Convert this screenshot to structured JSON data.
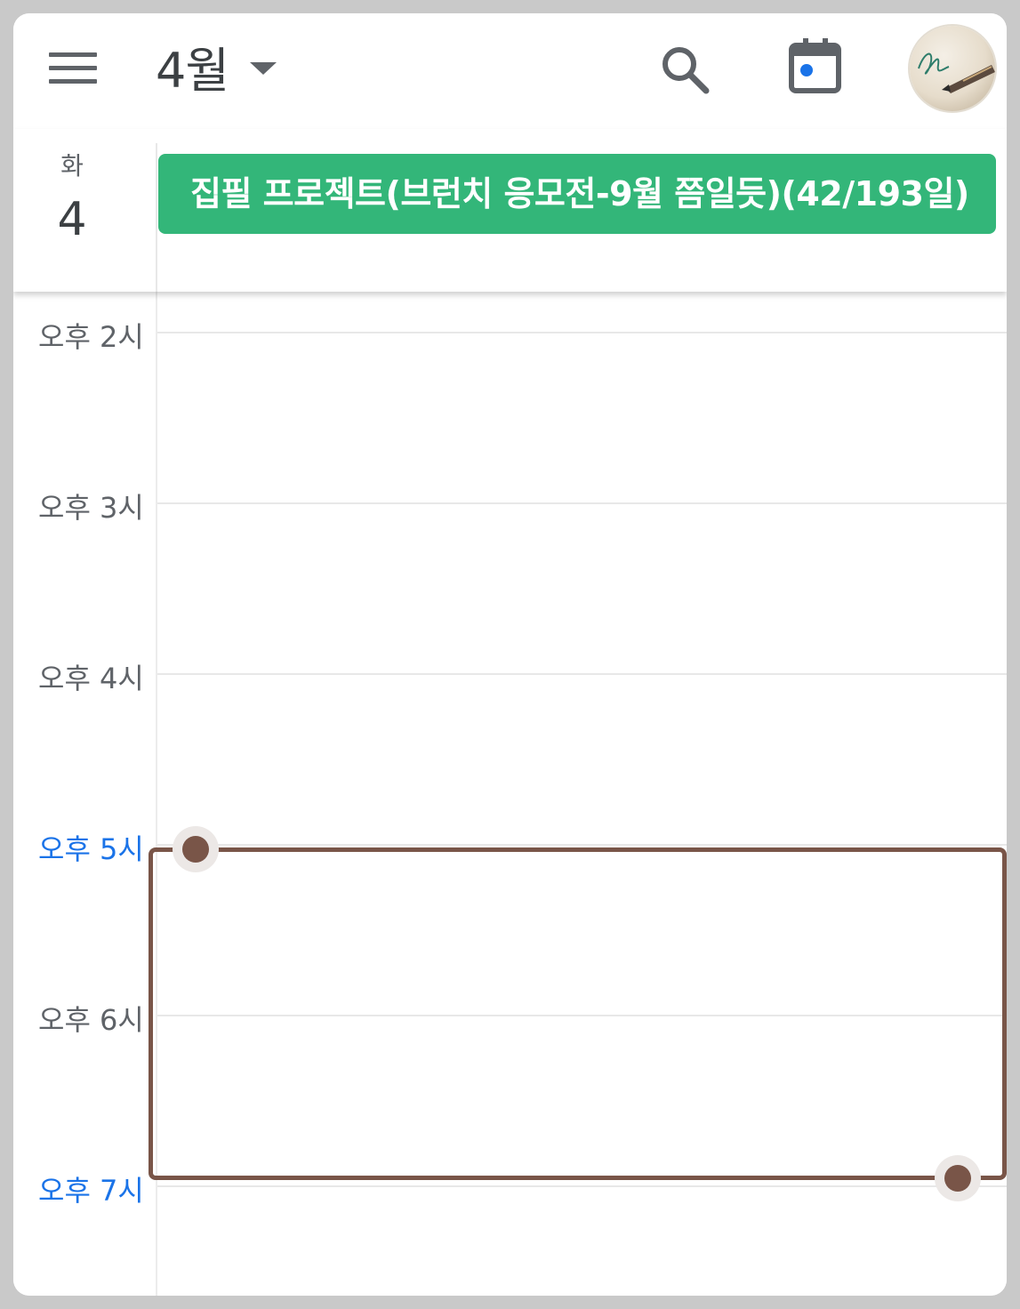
{
  "appbar": {
    "menu_icon": "menu-icon",
    "month_label": "4월",
    "month_caret_icon": "arrow-drop-down-icon",
    "search_icon": "search-icon",
    "today_icon": "calendar-today-icon",
    "avatar_icon": "profile-avatar"
  },
  "day": {
    "weekday": "화",
    "date": "4"
  },
  "all_day_events": [
    {
      "title": "집필 프로젝트(브런치 응모전-9월 쯤일듯)(42/193일)",
      "color": "#33b679"
    }
  ],
  "hours": [
    {
      "label": "오후 2시",
      "accent": false
    },
    {
      "label": "오후 3시",
      "accent": false
    },
    {
      "label": "오후 4시",
      "accent": false
    },
    {
      "label": "오후 5시",
      "accent": true
    },
    {
      "label": "오후 6시",
      "accent": false
    },
    {
      "label": "오후 7시",
      "accent": true
    }
  ],
  "selection": {
    "start": "오후 5시",
    "end": "오후 7시",
    "color": "#795548"
  },
  "colors": {
    "accent_blue": "#1a73e8",
    "event_green": "#33b679",
    "selection_brown": "#795548",
    "today_dot": "#1a73e8"
  }
}
